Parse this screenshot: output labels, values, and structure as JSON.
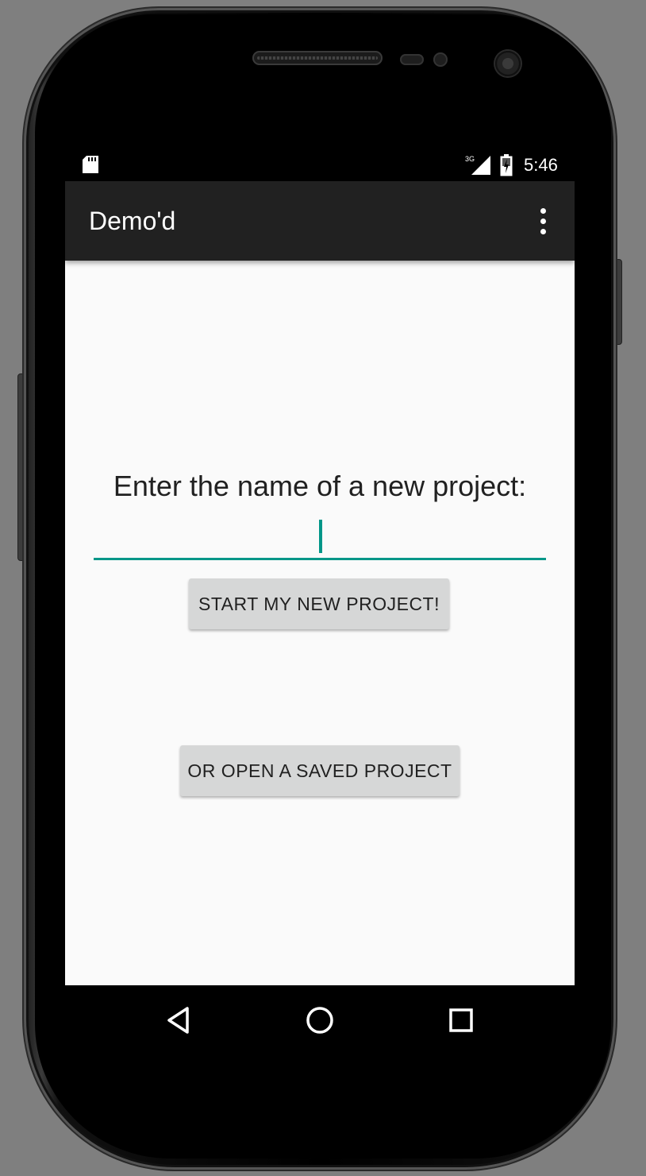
{
  "status_bar": {
    "time": "5:46",
    "network_type": "3G",
    "icons": [
      "sd-card-icon",
      "signal-icon",
      "battery-charging-icon"
    ]
  },
  "app_bar": {
    "title": "Demo'd",
    "menu_icon": "overflow-menu-icon"
  },
  "main": {
    "prompt": "Enter the name of a new project:",
    "project_name_value": "",
    "start_button_label": "START MY NEW PROJECT!",
    "open_saved_button_label": "OR OPEN A SAVED PROJECT"
  },
  "nav_bar": {
    "icons": [
      "back-icon",
      "home-icon",
      "recents-icon"
    ]
  },
  "colors": {
    "accent": "#009688",
    "app_bar": "#212121",
    "background": "#fafafa",
    "button": "#d6d7d7"
  }
}
